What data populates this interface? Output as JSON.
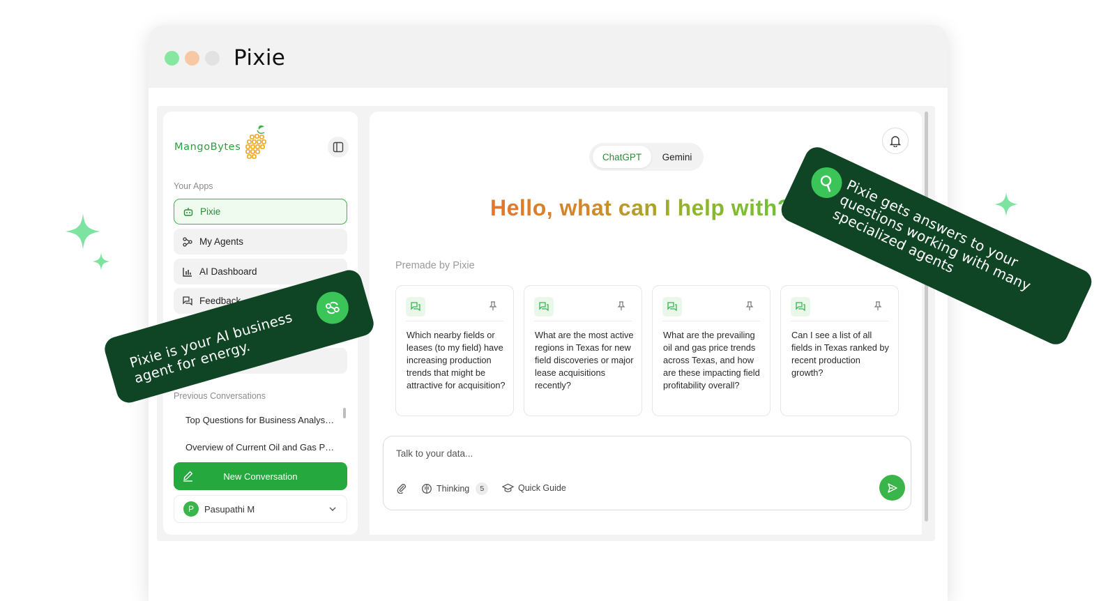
{
  "window": {
    "title": "Pixie"
  },
  "brand": {
    "logo_text": "MangoBytes"
  },
  "sidebar": {
    "apps_label": "Your Apps",
    "items": [
      {
        "label": "Pixie",
        "icon": "robot-icon",
        "active": true
      },
      {
        "label": "My Agents",
        "icon": "agents-icon"
      },
      {
        "label": "AI Dashboard",
        "icon": "bar-chart-icon"
      },
      {
        "label": "Feedback",
        "icon": "chat-icon"
      }
    ],
    "previous_label": "Previous Conversations",
    "conversations": [
      "Top Questions for Business Analys…",
      "Overview of Current Oil and Gas P…"
    ],
    "new_conversation_label": "New Conversation",
    "user": {
      "initial": "P",
      "name": "Pasupathi M"
    }
  },
  "main": {
    "models": [
      "ChatGPT",
      "Gemini"
    ],
    "selected_model": "ChatGPT",
    "greeting": "Hello, what can I help with?",
    "premade_label": "Premade by Pixie",
    "cards": [
      "Which nearby fields or leases (to my field) have increasing production trends that might be attractive for acquisition?",
      "What are the most active regions in Texas for new field discoveries or major lease acquisitions recently?",
      "What are the prevailing oil and gas price trends across Texas, and how are these impacting field profitability overall?",
      "Can I see a list of all fields in Texas ranked by recent production growth?"
    ],
    "composer": {
      "placeholder": "Talk to your data...",
      "thinking_label": "Thinking",
      "thinking_count": "5",
      "quick_guide_label": "Quick Guide"
    }
  },
  "banners": {
    "left": "Pixie is your AI business agent for energy.",
    "right": "Pixie gets answers to your questions working with many specialized agents"
  },
  "colors": {
    "accent": "#3ab54a",
    "banner": "#0f4524",
    "sparkle": "#7de3a0"
  }
}
